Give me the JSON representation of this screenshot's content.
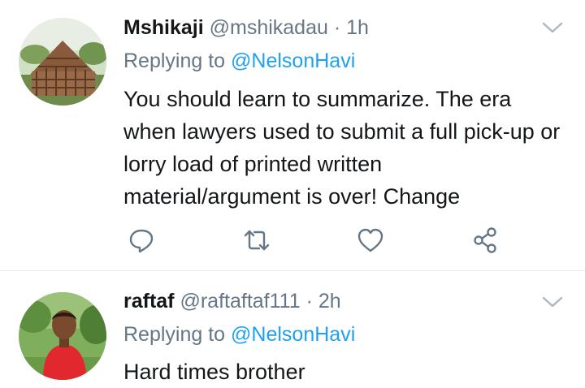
{
  "tweets": [
    {
      "name": "Mshikaji",
      "handle": "@mshikadau",
      "separator": "·",
      "time": "1h",
      "replying_prefix": "Replying to",
      "replying_to": "@NelsonHavi",
      "text": "You should learn to summarize. The era when lawyers used to submit a full pick-up or lorry load of printed written material/argument is over! Change"
    },
    {
      "name": "raftaf",
      "handle": "@raftaftaf111",
      "separator": "·",
      "time": "2h",
      "replying_prefix": "Replying to",
      "replying_to": "@NelsonHavi",
      "text": "Hard times brother"
    }
  ],
  "actions": [
    "reply-icon",
    "retweet-icon",
    "like-icon",
    "share-icon"
  ],
  "colors": {
    "text": "#14171a",
    "secondary": "#657786",
    "link": "#1da1f2",
    "divider": "#e6ecf0"
  }
}
